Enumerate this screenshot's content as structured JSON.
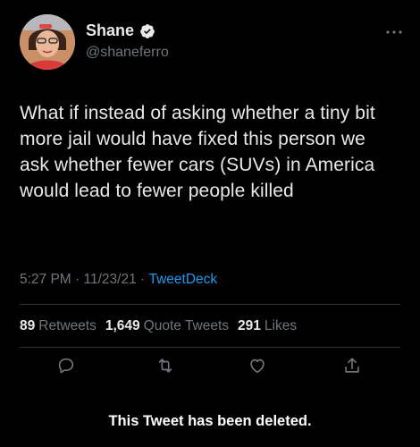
{
  "author": {
    "display_name": "Shane",
    "handle": "@shaneferro",
    "verified_icon": "verified-badge-icon",
    "avatar_icon": "profile-photo"
  },
  "tweet": {
    "text": "What if instead of asking whether a tiny bit more jail would have fixed this person we ask whether fewer cars (SUVs) in America would lead to fewer people killed",
    "time": "5:27 PM",
    "date": "11/23/21",
    "separator": " · ",
    "source": "TweetDeck"
  },
  "stats": {
    "retweets_count": "89",
    "retweets_label": "Retweets",
    "quote_count": "1,649",
    "quote_label": "Quote Tweets",
    "likes_count": "291",
    "likes_label": "Likes"
  },
  "actions": [
    "reply-icon",
    "retweet-icon",
    "like-icon",
    "share-icon"
  ],
  "banner": {
    "text": "This Tweet has been deleted."
  },
  "colors": {
    "background": "#000000",
    "text": "#e7e9ea",
    "secondary": "#71767b",
    "accent": "#1d9bf0"
  }
}
